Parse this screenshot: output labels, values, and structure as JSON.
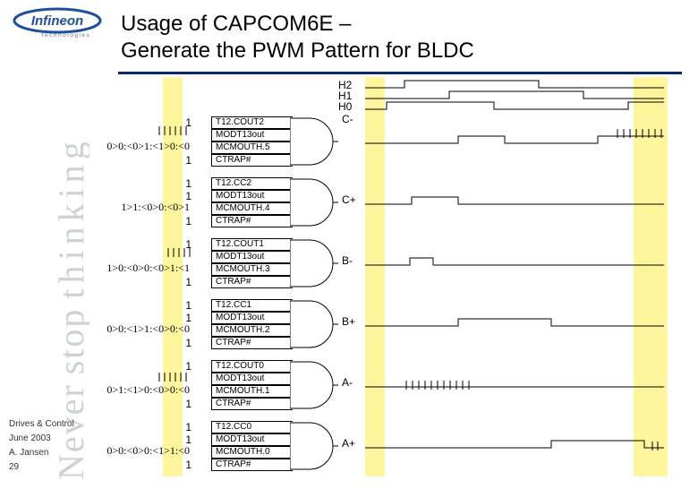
{
  "logo": {
    "brand": "Infineon",
    "tagline": "technologies"
  },
  "title_line1": "Usage of CAPCOM6E –",
  "title_line2": "Generate the PWM Pattern for BLDC",
  "sidebar": {
    "never": "Never",
    "stop": "stop",
    "thinking": "thinking"
  },
  "meta": {
    "group": "Drives & Control",
    "date": "June 2003",
    "author": "A. Jansen",
    "page": "29"
  },
  "hall": {
    "h2": "H2",
    "h1": "H1",
    "h0": "H0"
  },
  "groups": [
    {
      "seq": "0>0:<0>1:<1>0:<0",
      "phase": "C-",
      "rows": [
        {
          "en": "1",
          "sig": "T12.COUT2"
        },
        {
          "en": "",
          "sig": "MODT13out"
        },
        {
          "en": "",
          "sig": "MCMOUTH.5"
        },
        {
          "en": "1",
          "sig": "CTRAP#"
        }
      ]
    },
    {
      "seq": "1>1:<0>0:<0>1",
      "phase": "C+",
      "rows": [
        {
          "en": "1",
          "sig": "T12.CC2"
        },
        {
          "en": "1",
          "sig": "MODT13out"
        },
        {
          "en": "",
          "sig": "MCMOUTH.4"
        },
        {
          "en": "1",
          "sig": "CTRAP#"
        }
      ]
    },
    {
      "seq": "1>0:<0>0:<0>1:<1",
      "phase": "B-",
      "rows": [
        {
          "en": "1",
          "sig": "T12.COUT1"
        },
        {
          "en": "",
          "sig": "MODT13out"
        },
        {
          "en": "",
          "sig": "MCMOUTH.3"
        },
        {
          "en": "1",
          "sig": "CTRAP#"
        }
      ]
    },
    {
      "seq": "0>0:<1>1:<0>0:<0",
      "phase": "B+",
      "rows": [
        {
          "en": "1",
          "sig": "T12.CC1"
        },
        {
          "en": "1",
          "sig": "MODT13out"
        },
        {
          "en": "",
          "sig": "MCMOUTH.2"
        },
        {
          "en": "1",
          "sig": "CTRAP#"
        }
      ]
    },
    {
      "seq": "0>1:<1>0:<0>0:<0",
      "phase": "A-",
      "rows": [
        {
          "en": "1",
          "sig": "T12.COUT0"
        },
        {
          "en": "",
          "sig": "MODT13out"
        },
        {
          "en": "",
          "sig": "MCMOUTH.1"
        },
        {
          "en": "1",
          "sig": "CTRAP#"
        }
      ]
    },
    {
      "seq": "0>0:<0>0:<1>1:<0",
      "phase": "A+",
      "rows": [
        {
          "en": "1",
          "sig": "T12.CC0"
        },
        {
          "en": "1",
          "sig": "MODT13out"
        },
        {
          "en": "",
          "sig": "MCMOUTH.0"
        },
        {
          "en": "1",
          "sig": "CTRAP#"
        }
      ]
    }
  ]
}
